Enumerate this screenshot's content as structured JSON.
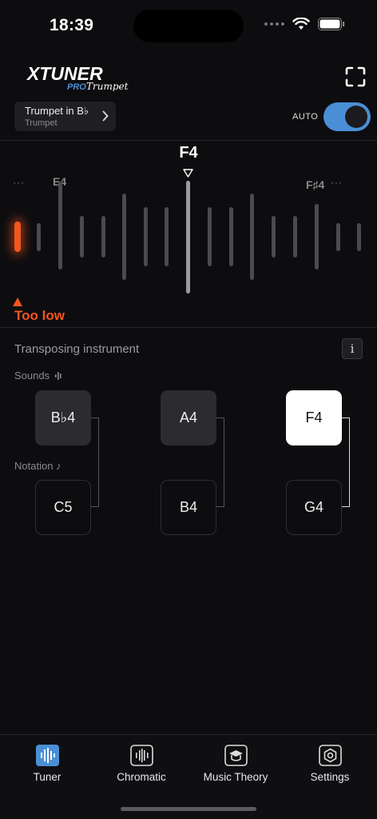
{
  "status": {
    "time": "18:39"
  },
  "header": {
    "logo_text": "XTUNER",
    "logo_pro": "PRO",
    "logo_sub": "Trumpet",
    "instrument_name": "Trumpet in B♭",
    "instrument_sub": "Trumpet",
    "auto_label": "AUTO",
    "auto_on": true
  },
  "tuner": {
    "current_note": "F4",
    "left_note": "E4",
    "right_note": "F♯4",
    "more": "···",
    "status": "Too low",
    "accent": "#f3561f"
  },
  "transposing": {
    "title": "Transposing instrument",
    "info_label": "i",
    "sounds_label": "Sounds",
    "notation_label": "Notation ♪",
    "sounds": [
      "B♭4",
      "A4",
      "F4"
    ],
    "notations": [
      "C5",
      "B4",
      "G4"
    ],
    "selected_index": 2
  },
  "tabs": [
    {
      "label": "Tuner",
      "icon": "tuner-icon",
      "active": true
    },
    {
      "label": "Chromatic",
      "icon": "chromatic-icon",
      "active": false
    },
    {
      "label": "Music Theory",
      "icon": "music-theory-icon",
      "active": false
    },
    {
      "label": "Settings",
      "icon": "settings-icon",
      "active": false
    }
  ]
}
